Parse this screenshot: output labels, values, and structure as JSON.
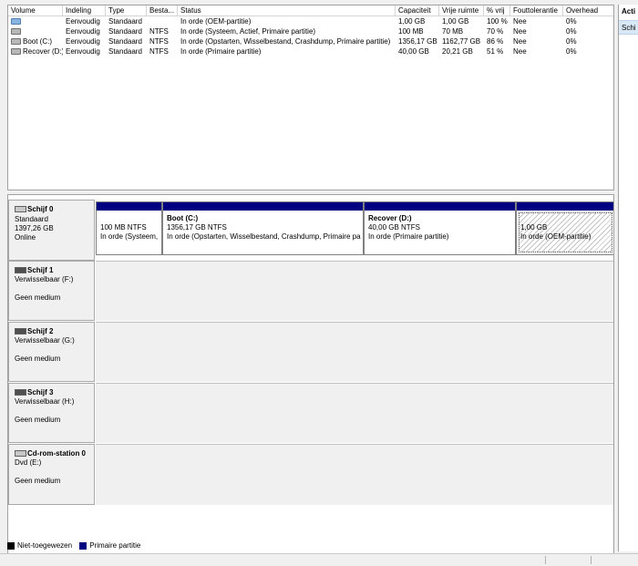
{
  "volume_list": {
    "columns": [
      "Volume",
      "Indeling",
      "Type",
      "Besta...",
      "Status",
      "Capaciteit",
      "Vrije ruimte",
      "% vrij",
      "Fouttolerantie",
      "Overhead"
    ],
    "rows": [
      {
        "icon": "volume-blue-icon",
        "volume": "",
        "layout": "Eenvoudig",
        "type": "Standaard",
        "fs": "",
        "status": "In orde (OEM-partitie)",
        "capacity": "1,00 GB",
        "free": "1,00 GB",
        "pct": "100 %",
        "fault": "Nee",
        "overhead": "0%"
      },
      {
        "icon": "volume-gray-icon",
        "volume": "",
        "layout": "Eenvoudig",
        "type": "Standaard",
        "fs": "NTFS",
        "status": "In orde (Systeem, Actief, Primaire partitie)",
        "capacity": "100 MB",
        "free": "70 MB",
        "pct": "70 %",
        "fault": "Nee",
        "overhead": "0%"
      },
      {
        "icon": "volume-gray-icon",
        "volume": "Boot (C:)",
        "layout": "Eenvoudig",
        "type": "Standaard",
        "fs": "NTFS",
        "status": "In orde (Opstarten, Wisselbestand, Crashdump, Primaire partitie)",
        "capacity": "1356,17 GB",
        "free": "1162,77 GB",
        "pct": "86 %",
        "fault": "Nee",
        "overhead": "0%"
      },
      {
        "icon": "volume-gray-icon",
        "volume": "Recover (D:)",
        "layout": "Eenvoudig",
        "type": "Standaard",
        "fs": "NTFS",
        "status": "In orde (Primaire partitie)",
        "capacity": "40,00 GB",
        "free": "20,21 GB",
        "pct": "51 %",
        "fault": "Nee",
        "overhead": "0%"
      }
    ]
  },
  "actions": {
    "title": "Acti",
    "item": "Schi"
  },
  "disks": [
    {
      "icon": "hard-disk-icon",
      "name": "Schijf 0",
      "line2": "Standaard",
      "line3": "1397,26 GB",
      "line4": "Online",
      "partitions": [
        {
          "title": "",
          "size": "100 MB NTFS",
          "status": "In orde (Systeem,"
        },
        {
          "title": "Boot  (C:)",
          "size": "1356,17 GB NTFS",
          "status": "In orde (Opstarten, Wisselbestand, Crashdump, Primaire pa"
        },
        {
          "title": "Recover  (D:)",
          "size": "40,00 GB NTFS",
          "status": "In orde (Primaire partitie)"
        },
        {
          "title": "",
          "size": "1,00 GB",
          "status": "In orde (OEM-partitie)"
        }
      ]
    },
    {
      "icon": "removable-disk-icon",
      "name": "Schijf 1",
      "line2": "Verwisselbaar (F:)",
      "line3": "Geen medium"
    },
    {
      "icon": "removable-disk-icon",
      "name": "Schijf 2",
      "line2": "Verwisselbaar (G:)",
      "line3": "Geen medium"
    },
    {
      "icon": "removable-disk-icon",
      "name": "Schijf 3",
      "line2": "Verwisselbaar (H:)",
      "line3": "Geen medium"
    },
    {
      "icon": "cdrom-drive-icon",
      "name": "Cd-rom-station 0",
      "line2": "Dvd (E:)",
      "line3": "Geen medium"
    }
  ],
  "legend": [
    {
      "label": "Niet-toegewezen",
      "color": "#000000"
    },
    {
      "label": "Primaire partitie",
      "color": "#000080"
    }
  ]
}
